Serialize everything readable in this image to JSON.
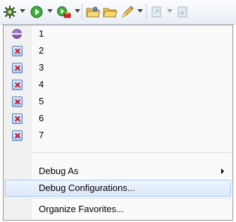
{
  "toolbar": {
    "buttons": [
      {
        "name": "debug",
        "icon": "bug-gear-icon",
        "has_dropdown": true
      },
      {
        "name": "run",
        "icon": "green-play-circle-icon",
        "has_dropdown": true
      },
      {
        "name": "run-external-tool",
        "icon": "external-tools-icon",
        "has_dropdown": true
      },
      {
        "name": "open-type",
        "icon": "open-folder-icon",
        "has_dropdown": false
      },
      {
        "name": "open-resource",
        "icon": "folder-icon",
        "has_dropdown": false
      },
      {
        "name": "search",
        "icon": "pencil-icon",
        "has_dropdown": true
      },
      {
        "name": "next-annotation",
        "icon": "next-annotation-icon",
        "has_dropdown": true
      },
      {
        "name": "previous-annotation",
        "icon": "previous-annotation-icon",
        "has_dropdown": false
      }
    ]
  },
  "menu": {
    "history": [
      {
        "label": "1",
        "icon": "debug-launch-icon"
      },
      {
        "label": "2",
        "icon": "x-launch-icon"
      },
      {
        "label": "3",
        "icon": "x-launch-icon"
      },
      {
        "label": "4",
        "icon": "x-launch-icon"
      },
      {
        "label": "5",
        "icon": "x-launch-icon"
      },
      {
        "label": "6",
        "icon": "x-launch-icon"
      },
      {
        "label": "7",
        "icon": "x-launch-icon"
      }
    ],
    "debug_as": "Debug As",
    "debug_configurations": "Debug Configurations...",
    "organize_favorites": "Organize Favorites...",
    "highlighted_item": "Debug Configurations..."
  },
  "colors": {
    "highlight_border": "#a8c8f0",
    "menu_border": "#979797",
    "gutter": "#f1f1f1"
  }
}
